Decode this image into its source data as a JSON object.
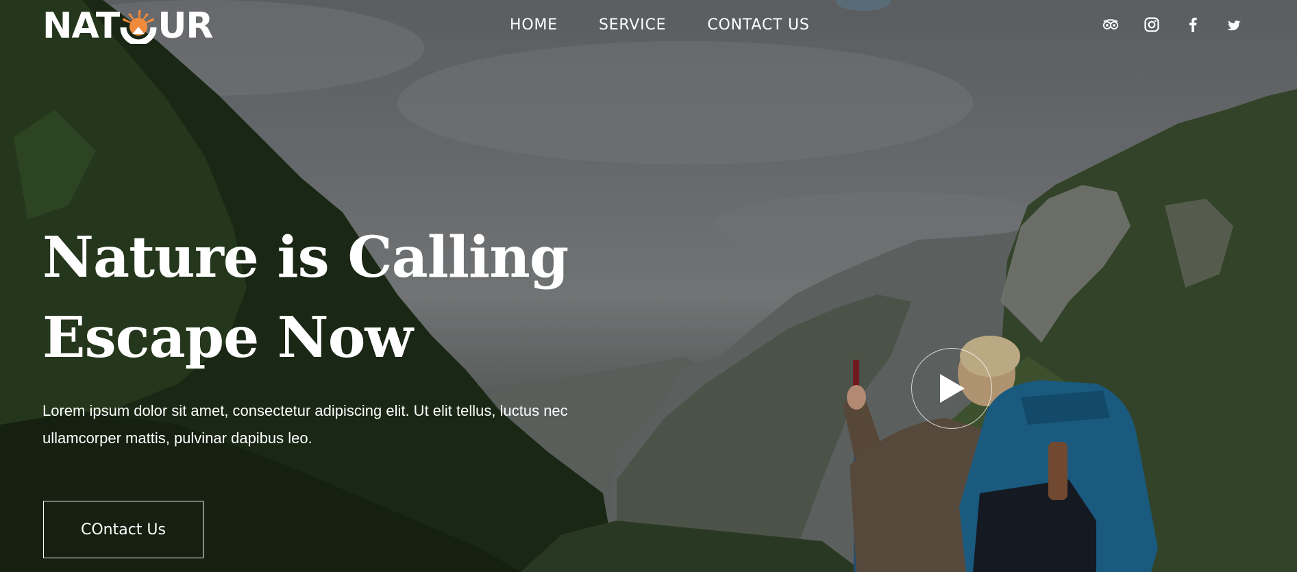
{
  "brand": {
    "logo_text_left": "NAT",
    "logo_text_right": "UR",
    "logo_accent_color": "#f08a3c"
  },
  "nav": {
    "items": [
      {
        "label": "HOME"
      },
      {
        "label": "SERVICE"
      },
      {
        "label": "CONTACT US"
      }
    ]
  },
  "social": {
    "icons": [
      "tripadvisor-icon",
      "instagram-icon",
      "facebook-icon",
      "twitter-icon"
    ]
  },
  "hero": {
    "title_line1": "Nature is Calling",
    "title_line2": "Escape Now",
    "description": "Lorem ipsum dolor sit amet, consectetur adipiscing elit. Ut elit tellus, luctus nec ullamcorper mattis, pulvinar dapibus leo.",
    "cta_label": "COntact Us",
    "play_icon": "play-icon"
  }
}
